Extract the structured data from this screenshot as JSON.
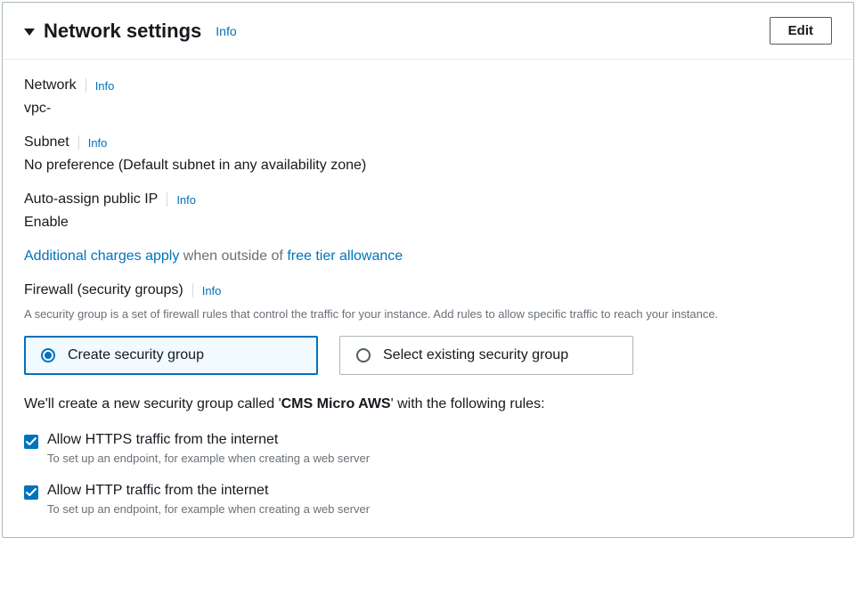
{
  "header": {
    "title": "Network settings",
    "info": "Info",
    "edit": "Edit"
  },
  "network": {
    "label": "Network",
    "info": "Info",
    "value": "vpc-"
  },
  "subnet": {
    "label": "Subnet",
    "info": "Info",
    "value": "No preference (Default subnet in any availability zone)"
  },
  "publicIp": {
    "label": "Auto-assign public IP",
    "info": "Info",
    "value": "Enable"
  },
  "charges": {
    "link1": "Additional charges apply",
    "middle": " when outside of ",
    "link2": "free tier allowance"
  },
  "firewall": {
    "label": "Firewall (security groups)",
    "info": "Info",
    "desc": "A security group is a set of firewall rules that control the traffic for your instance. Add rules to allow specific traffic to reach your instance.",
    "options": {
      "create": "Create security group",
      "select": "Select existing security group"
    }
  },
  "sgIntro": {
    "prefix": "We'll create a new security group called '",
    "name": "CMS Micro AWS",
    "suffix": "' with the following rules:"
  },
  "rules": {
    "https": {
      "label": "Allow HTTPS traffic from the internet",
      "desc": "To set up an endpoint, for example when creating a web server"
    },
    "http": {
      "label": "Allow HTTP traffic from the internet",
      "desc": "To set up an endpoint, for example when creating a web server"
    }
  }
}
